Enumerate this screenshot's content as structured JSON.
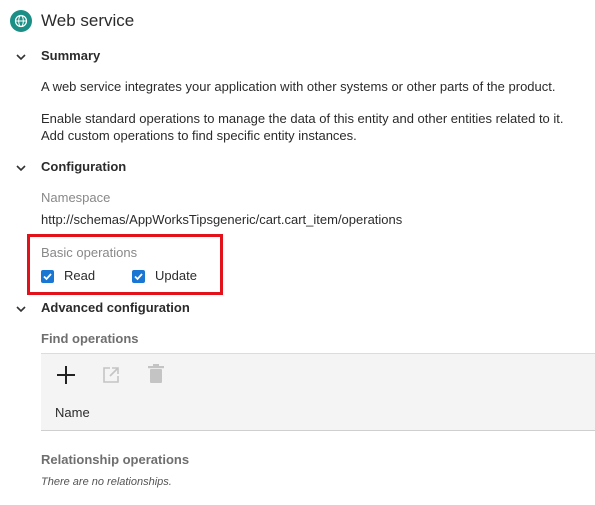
{
  "header": {
    "title": "Web service"
  },
  "summary": {
    "title": "Summary",
    "text1": "A web service integrates your application with other systems or other parts of the product.",
    "text2a": "Enable standard operations to manage the data of this entity and other entities related to it.",
    "text2b": "Add custom operations to find specific entity instances."
  },
  "configuration": {
    "title": "Configuration",
    "namespace_label": "Namespace",
    "namespace_value": "http://schemas/AppWorksTipsgeneric/cart.cart_item/operations",
    "basic_ops_label": "Basic operations",
    "read_label": "Read",
    "update_label": "Update"
  },
  "advanced": {
    "title": "Advanced configuration",
    "find_ops_label": "Find operations",
    "grid_column_name": "Name",
    "relationship_label": "Relationship operations",
    "no_relationships": "There are no relationships."
  },
  "colors": {
    "accent": "#1b8e86",
    "checkbox": "#1976d2",
    "highlight": "#e3121a"
  },
  "icons": {
    "header": "globe-icon",
    "add": "plus-icon",
    "open": "open-external-icon",
    "delete": "trash-icon"
  }
}
